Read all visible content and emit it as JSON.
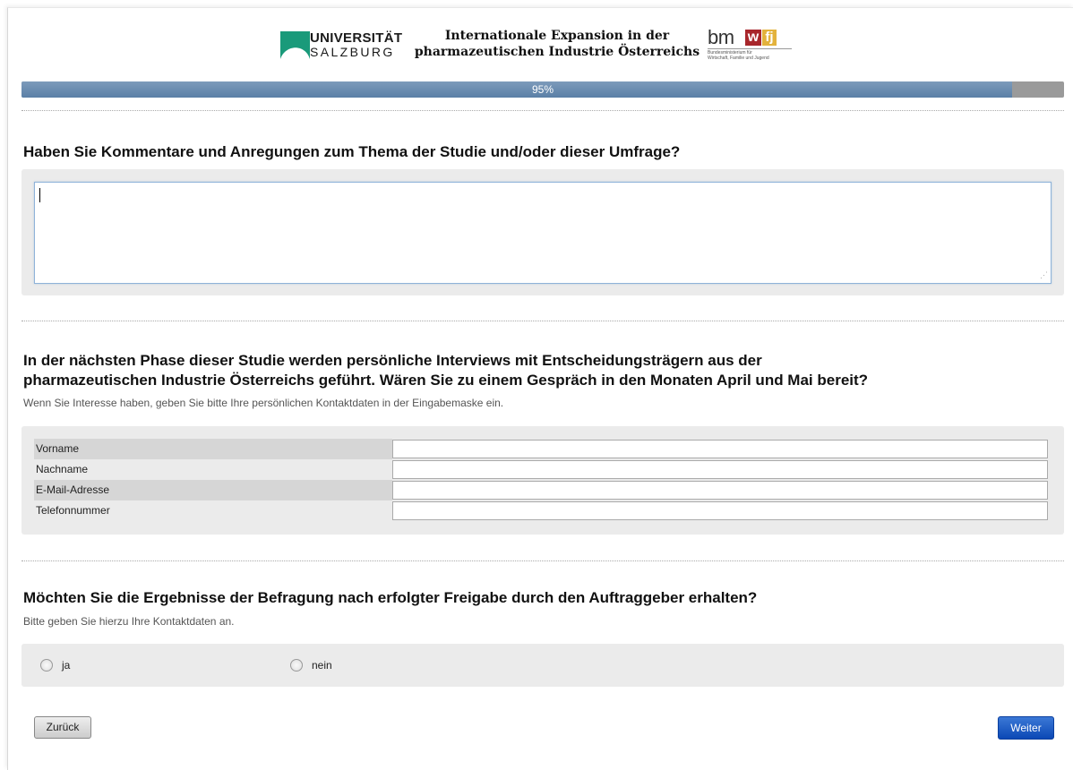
{
  "header": {
    "university": {
      "line1": "UNIVERSITÄT",
      "line2": "SALZBURG"
    },
    "study_title_line1": "Internationale Expansion in der",
    "study_title_line2": "pharmazeutischen Industrie Österreichs",
    "ministry_logo": {
      "bm": "bm",
      "w": "w",
      "fj": "fj",
      "sub_line1": "Bundesministerium für",
      "sub_line2": "Wirtschaft, Familie und Jugend"
    }
  },
  "progress": {
    "value": 0.95,
    "label": "95%"
  },
  "questions": {
    "comments": {
      "title": "Haben Sie Kommentare und Anregungen zum Thema der Studie und/oder dieser Umfrage?",
      "value": ""
    },
    "interview": {
      "title_line1": "In der nächsten Phase dieser Studie werden persönliche Interviews mit Entscheidungsträgern aus der",
      "title_line2": "pharmazeutischen Industrie Österreichs geführt. Wären Sie zu einem Gespräch in den Monaten April und Mai bereit?",
      "help": "Wenn Sie Interesse haben, geben Sie bitte Ihre persönlichen Kontaktdaten in der Eingabemaske ein.",
      "fields": [
        {
          "label": "Vorname",
          "value": ""
        },
        {
          "label": "Nachname",
          "value": ""
        },
        {
          "label": "E-Mail-Adresse",
          "value": ""
        },
        {
          "label": "Telefonnummer",
          "value": ""
        }
      ]
    },
    "results": {
      "title": "Möchten Sie die Ergebnisse der Befragung nach erfolgter Freigabe durch den Auftraggeber erhalten?",
      "help": "Bitte geben Sie hierzu Ihre Kontaktdaten an.",
      "options": [
        {
          "label": "ja",
          "selected": false
        },
        {
          "label": "nein",
          "selected": false
        }
      ]
    }
  },
  "nav": {
    "back_label": "Zurück",
    "next_label": "Weiter"
  },
  "colors": {
    "progress_fill": "#6a8db3",
    "next_button": "#1a5bc8",
    "uni_green": "#1a9a7a"
  }
}
